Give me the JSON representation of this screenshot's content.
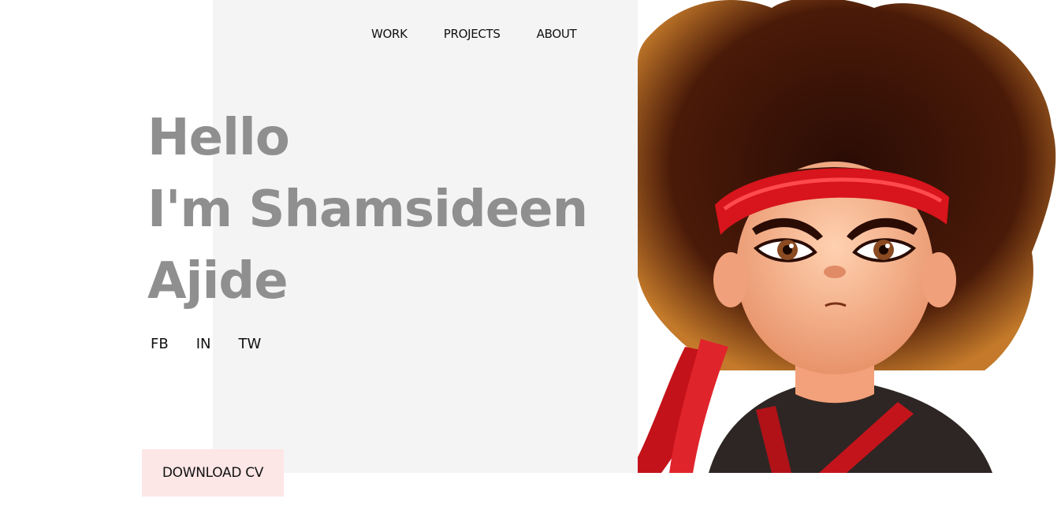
{
  "nav": {
    "items": [
      {
        "label": "WORK"
      },
      {
        "label": "PROJECTS"
      },
      {
        "label": "ABOUT"
      }
    ]
  },
  "hero": {
    "line1": "Hello",
    "line2": "I'm Shamsideen",
    "line3": "Ajide"
  },
  "social": {
    "items": [
      {
        "label": "FB"
      },
      {
        "label": "IN"
      },
      {
        "label": "TW"
      }
    ]
  },
  "cta": {
    "label": "DOWNLOAD CV"
  },
  "colors": {
    "panel": "#f4f4f4",
    "headline": "#8f8f8f",
    "button_bg": "#fde6e6",
    "headband": "#d8141c",
    "hair": "#3a1508"
  }
}
